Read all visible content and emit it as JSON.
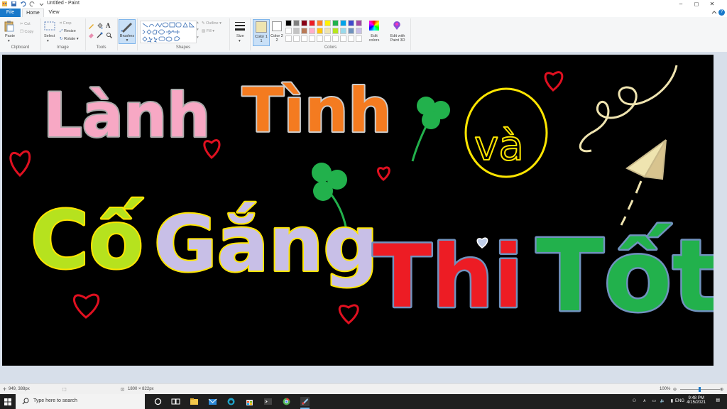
{
  "window": {
    "title": "Untitled - Paint",
    "minimize": "–",
    "maximize": "◻",
    "close": "✕"
  },
  "tabs": {
    "file": "File",
    "home": "Home",
    "view": "View"
  },
  "clipboard": {
    "label": "Clipboard",
    "paste": "Paste",
    "cut": "Cut",
    "copy": "Copy"
  },
  "image": {
    "label": "Image",
    "select": "Select",
    "crop": "Crop",
    "resize": "Resize",
    "rotate": "Rotate"
  },
  "tools": {
    "label": "Tools"
  },
  "brushes": {
    "label": "Brushes"
  },
  "shapes": {
    "label": "Shapes",
    "outline": "Outline",
    "fill": "Fill"
  },
  "size": {
    "label": "Size"
  },
  "colors": {
    "label": "Colors",
    "color1": "Color 1",
    "color1_num": "1",
    "color2": "Color 2",
    "color2_num": "2",
    "edit_colors": "Edit colors",
    "edit_paint3d": "Edit with Paint 3D",
    "palette_row1": [
      "#000000",
      "#7f7f7f",
      "#880015",
      "#ed1c24",
      "#ff7f27",
      "#fff200",
      "#22b14c",
      "#00a2e8",
      "#3f48cc",
      "#a349a4"
    ],
    "palette_row2": [
      "#ffffff",
      "#c3c3c3",
      "#b97a57",
      "#ffaec9",
      "#ffc90e",
      "#efe4b0",
      "#b5e61d",
      "#99d9ea",
      "#7092be",
      "#c8bfe7"
    ]
  },
  "status": {
    "cursor": "949, 388px",
    "dimensions": "1800 × 822px",
    "zoom": "100%"
  },
  "taskbar": {
    "search_placeholder": "Type here to search",
    "lang": "ENG",
    "time": "9:48 PM",
    "date": "4/15/2021"
  },
  "drawing": {
    "words": [
      "Lành",
      "Tình",
      "và",
      "Cố",
      "Gắng",
      "Thi",
      "Tốt"
    ]
  }
}
